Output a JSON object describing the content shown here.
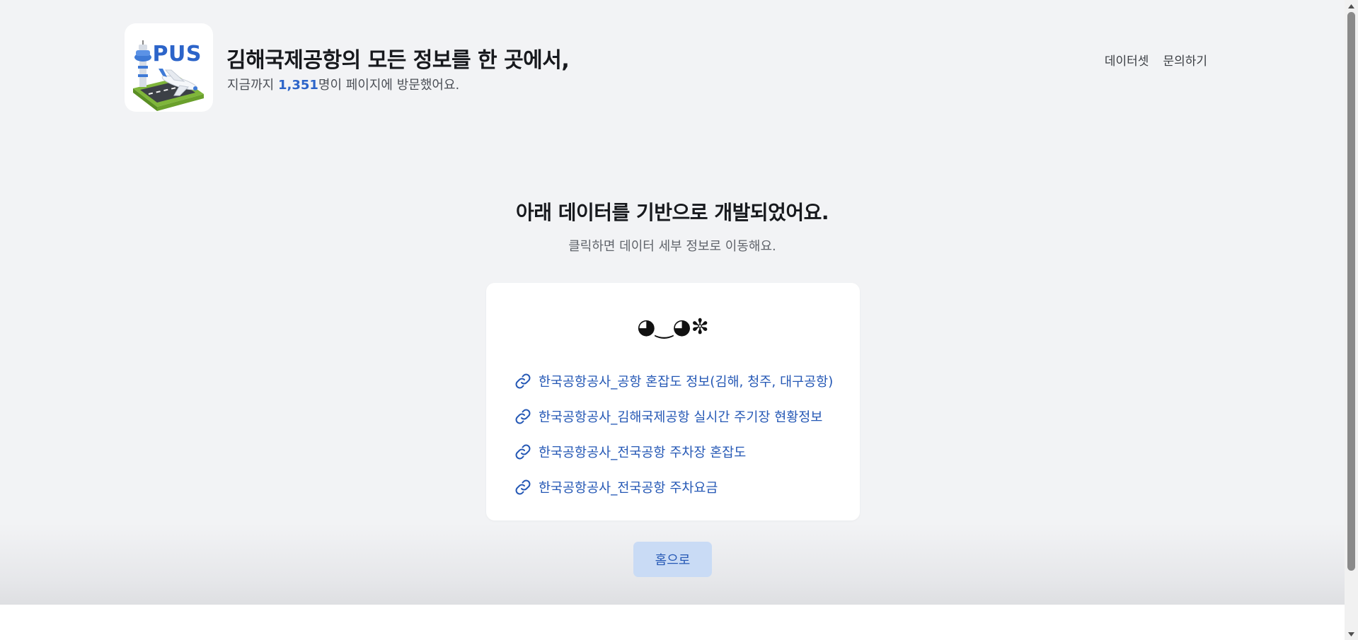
{
  "header": {
    "logo_text": "PUS",
    "title": "김해국제공항의 모든 정보를 한 곳에서,",
    "visit_prefix": "지금까지 ",
    "visit_count": "1,351",
    "visit_suffix": "명이 페이지에 방문했어요."
  },
  "nav": {
    "items": [
      "데이터셋",
      "문의하기"
    ]
  },
  "main": {
    "title": "아래 데이터를 기반으로 개발되었어요.",
    "subtitle": "클릭하면 데이터 세부 정보로 이동해요.",
    "kaomoji": "◕‿◕✼",
    "links": [
      "한국공항공사_공항 혼잡도 정보(김해, 청주, 대구공항)",
      "한국공항공사_김해국제공항 실시간 주기장 현황정보",
      "한국공항공사_전국공항 주차장 혼잡도",
      "한국공항공사_전국공항 주차요금"
    ],
    "home_button": "홈으로"
  },
  "colors": {
    "accent": "#2c64c9",
    "link": "#2558b5",
    "button_bg": "#c9dbf5",
    "page_bg": "#f2f3f5"
  }
}
